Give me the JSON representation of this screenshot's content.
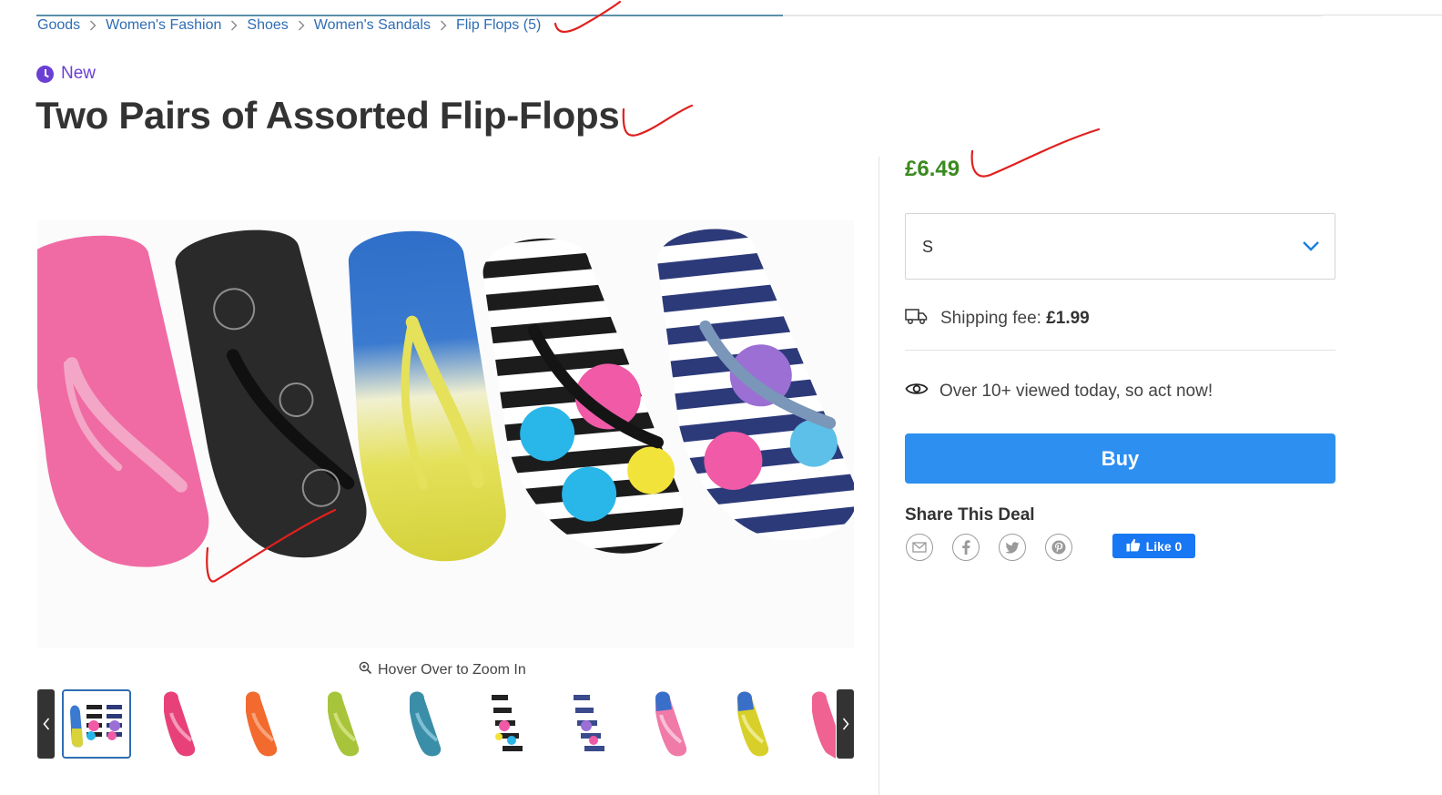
{
  "breadcrumb": [
    {
      "label": "Goods"
    },
    {
      "label": "Women's Fashion"
    },
    {
      "label": "Shoes"
    },
    {
      "label": "Women's Sandals"
    },
    {
      "label": "Flip Flops (5)"
    }
  ],
  "badge": {
    "label": "New"
  },
  "product": {
    "title": "Two Pairs of Assorted Flip-Flops",
    "price": "£6.49"
  },
  "gallery": {
    "zoom_hint": "Hover Over to Zoom In",
    "thumbnails": [
      {
        "icon": "flip-flop-set-icon",
        "selected": true
      },
      {
        "icon": "pink-flip-flop-icon",
        "color": "#e8417a"
      },
      {
        "icon": "orange-flip-flop-icon",
        "color": "#f26a2e"
      },
      {
        "icon": "lime-flip-flop-icon",
        "color": "#a8c43a"
      },
      {
        "icon": "teal-flip-flop-icon",
        "color": "#3a8ea8"
      },
      {
        "icon": "black-floral-flip-flop-icon",
        "color": "#222222"
      },
      {
        "icon": "navy-floral-flip-flop-icon",
        "color": "#3b4a8c"
      },
      {
        "icon": "blue-pink-flip-flop-icon",
        "color": "#f07aa8"
      },
      {
        "icon": "blue-yellow-flip-flop-icon",
        "color": "#d8d02a"
      },
      {
        "icon": "pink-partial-flip-flop-icon",
        "color": "#f06292"
      }
    ]
  },
  "size_select": {
    "value": "S"
  },
  "shipping": {
    "label": "Shipping fee:",
    "value": "£1.99"
  },
  "views": {
    "text": "Over 10+ viewed today, so act now!"
  },
  "buy": {
    "label": "Buy"
  },
  "share": {
    "title": "Share This Deal",
    "icons": [
      "email-icon",
      "facebook-icon",
      "twitter-icon",
      "pinterest-icon"
    ],
    "like_label": "Like 0"
  },
  "colors": {
    "link": "#2f6db3",
    "badge": "#6a3fd4",
    "price": "#3a8a1f",
    "buy": "#2d8ff0",
    "facebook": "#1877f2",
    "annotation": "#e0201e"
  }
}
